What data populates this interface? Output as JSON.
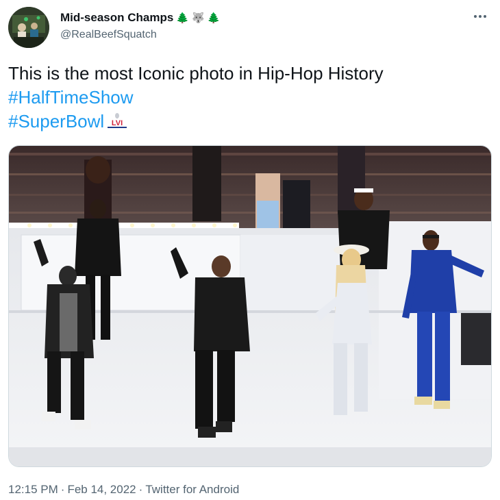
{
  "author": {
    "display_name": "Mid-season Champs",
    "name_emojis": [
      "🌲",
      "🐺",
      "🌲"
    ],
    "handle": "@RealBeefSquatch",
    "avatar_icon": "profile-photo-avatar"
  },
  "menu": {
    "icon": "more-options-icon"
  },
  "tweet": {
    "text_line1": "This is the most Iconic photo in Hip-Hop History",
    "hashtag1": "#HalfTimeShow",
    "hashtag2": "#SuperBowl",
    "hashtag2_logo": "LVI",
    "hashtag_color": "#1d9bf0"
  },
  "media": {
    "type": "photo",
    "icon": "halftime-show-stage-photo"
  },
  "meta": {
    "time": "12:15 PM",
    "date": "Feb 14, 2022",
    "source": "Twitter for Android",
    "separator": "·"
  },
  "colors": {
    "text": "#0f1419",
    "secondary": "#536471",
    "link": "#1d9bf0",
    "border": "#cfd9de"
  }
}
